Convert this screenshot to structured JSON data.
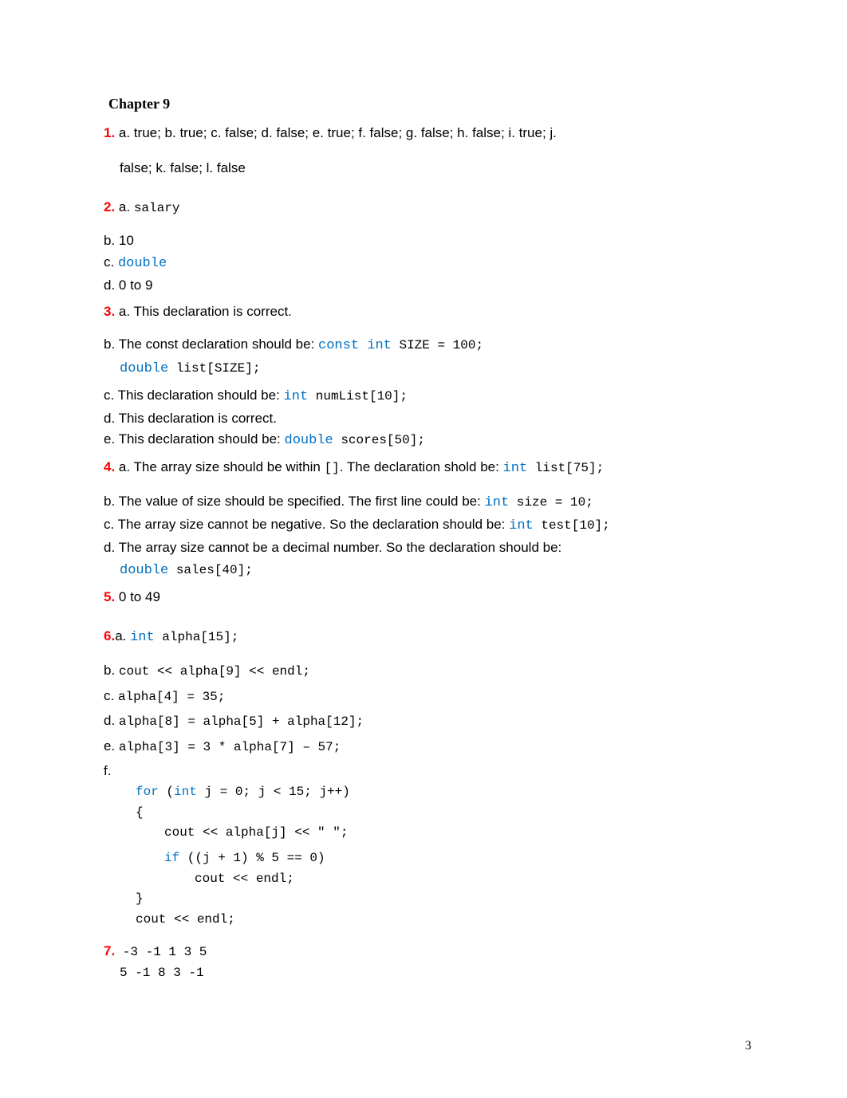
{
  "chapter_heading": "Chapter 9",
  "q1": {
    "num": "1.",
    "line1": " a. true; b. true; c. false; d. false; e. true; f. false; g. false; h. false; i. true; j.",
    "line2": "false; k. false; l. false"
  },
  "q2": {
    "num": "2.",
    "a_prefix": " a. ",
    "a_code": "salary",
    "b": "b. 10",
    "c_prefix": "c. ",
    "c_kw": "double",
    "d": "d. 0 to 9"
  },
  "q3": {
    "num": "3.",
    "a": "  a. This declaration is correct.",
    "b_text": "b. The const declaration should be: ",
    "b_kw": "const int",
    "b_code": " SIZE = 100;",
    "b_line2_kw": "double",
    "b_line2_code": " list[SIZE];",
    "c_text": "c. This declaration should be: ",
    "c_kw": "int",
    "c_code": " numList[10];",
    "d": "d. This declaration is correct.",
    "e_text": "e. This declaration should be: ",
    "e_kw": "double",
    "e_code": " scores[50];"
  },
  "q4": {
    "num": "4.",
    "a_text": "  a. The array size should be within ",
    "a_brackets": "[]",
    "a_text2": ". The declaration shold be: ",
    "a_kw": " int",
    "a_code": " list[75];",
    "b_text": "b. The value of size should be specified. The first line could be: ",
    "b_kw": " int",
    "b_code": " size = 10;",
    "c_text": "c. The array size cannot be negative. So the declaration should be: ",
    "c_kw": "int",
    "c_code": " test[10];",
    "d_text": "d. The array size cannot be a decimal number. So the declaration should be:",
    "d_kw": "double",
    "d_code": " sales[40];"
  },
  "q5": {
    "num": "5.",
    "text": " 0 to 49"
  },
  "q6": {
    "num": "6.",
    "a_prefix": "a. ",
    "a_kw": "int",
    "a_code": " alpha[15];",
    "b_prefix": "b. ",
    "b_code": "cout << alpha[9] << endl;",
    "c_prefix": "c.  ",
    "c_code": "alpha[4] = 35;",
    "d_prefix": "d.  ",
    "d_code": "alpha[8] = alpha[5] + alpha[12];",
    "e_prefix": "e.  ",
    "e_code": "alpha[3] = 3 * alpha[7] – 57;",
    "f_prefix": "f.",
    "f_l1a": "for",
    "f_l1b": " (",
    "f_l1c": "int",
    "f_l1d": " j = 0; j < 15; j++)",
    "f_l2": "{",
    "f_l3": "cout << alpha[j] << \"  \";",
    "f_l4a": "if",
    "f_l4b": " ((j + 1) % 5 == 0)",
    "f_l5": "cout << endl;",
    "f_l6": "}",
    "f_l7": "cout << endl;"
  },
  "q7": {
    "num": "7.",
    "line1": " -3 -1 1 3 5",
    "line2": "5 -1 8 3 -1"
  },
  "page_number": "3"
}
